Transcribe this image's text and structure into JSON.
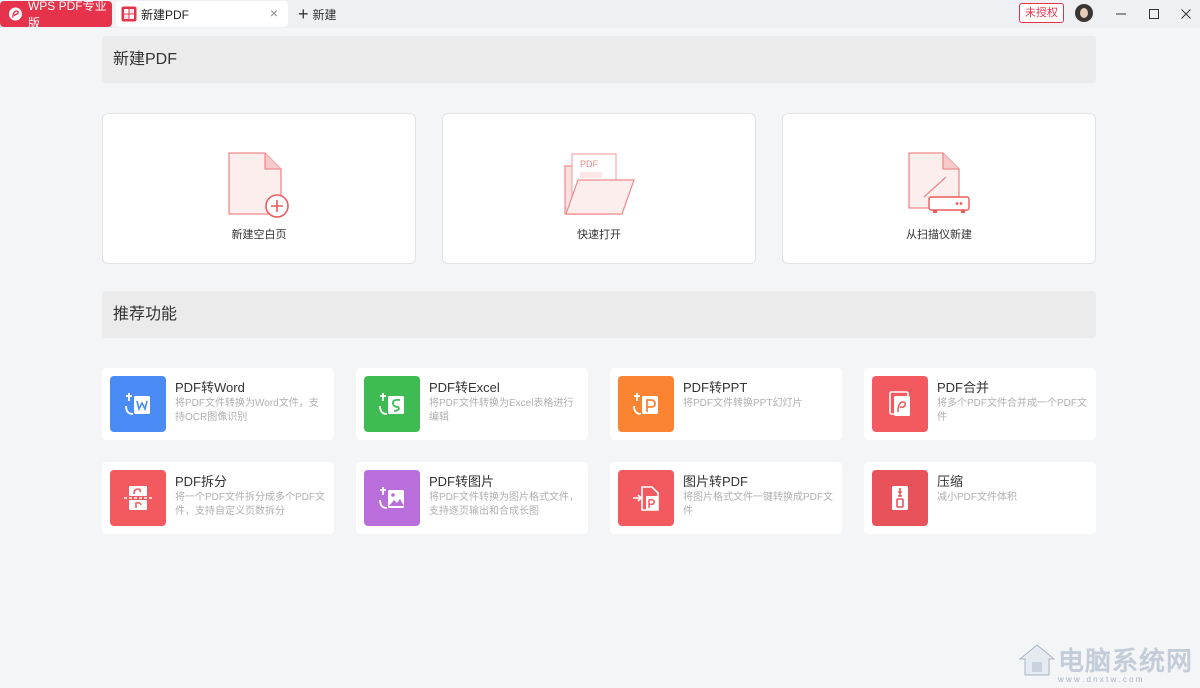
{
  "titlebar": {
    "app_label": "WPS PDF专业版",
    "doc_tab_label": "新建PDF",
    "new_tab_label": "新建",
    "unlicensed_label": "未授权"
  },
  "sections": {
    "create_title": "新建PDF",
    "recommend_title": "推荐功能"
  },
  "create_cards": [
    {
      "label": "新建空白页",
      "icon": "blank-page-icon"
    },
    {
      "label": "快速打开",
      "icon": "open-folder-icon"
    },
    {
      "label": "从扫描仪新建",
      "icon": "scanner-icon"
    }
  ],
  "features": [
    {
      "title": "PDF转Word",
      "desc": "将PDF文件转换为Word文件，支持OCR图像识别",
      "color": "#4a8bf5",
      "icon": "pdf-to-word-icon"
    },
    {
      "title": "PDF转Excel",
      "desc": "将PDF文件转换为Excel表格进行编辑",
      "color": "#3ebc53",
      "icon": "pdf-to-excel-icon"
    },
    {
      "title": "PDF转PPT",
      "desc": "将PDF文件转换PPT幻灯片",
      "color": "#fb8432",
      "icon": "pdf-to-ppt-icon"
    },
    {
      "title": "PDF合并",
      "desc": "将多个PDF文件合并成一个PDF文件",
      "color": "#f35a5f",
      "icon": "pdf-merge-icon"
    },
    {
      "title": "PDF拆分",
      "desc": "将一个PDF文件拆分成多个PDF文件，支持自定义页数拆分",
      "color": "#f35a5f",
      "icon": "pdf-split-icon"
    },
    {
      "title": "PDF转图片",
      "desc": "将PDF文件转换为图片格式文件，支持逐页输出和合成长图",
      "color": "#b96edb",
      "icon": "pdf-to-image-icon"
    },
    {
      "title": "图片转PDF",
      "desc": "将图片格式文件一键转换成PDF文件",
      "color": "#f35a5f",
      "icon": "image-to-pdf-icon"
    },
    {
      "title": "压缩",
      "desc": "减小PDF文件体积",
      "color": "#e8525a",
      "icon": "compress-icon"
    }
  ],
  "watermark": {
    "text": "电脑系统网",
    "url": "w w w . d n x t w . c o m"
  },
  "colors": {
    "accent": "#e7324b",
    "page_bg": "#f4f5f7",
    "section_bg": "#ebebeb"
  }
}
